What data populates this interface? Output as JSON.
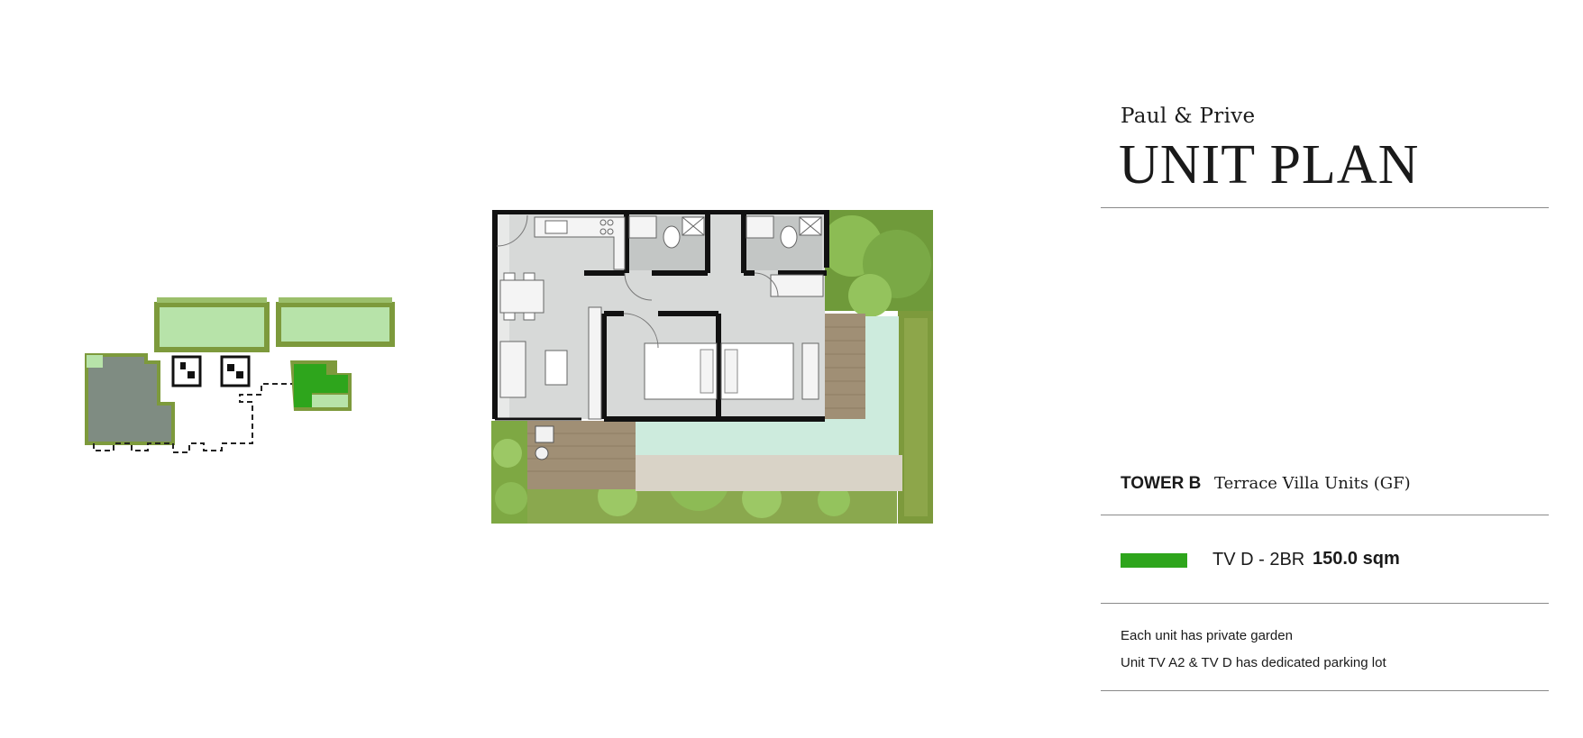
{
  "header": {
    "brand": "Paul & Prive",
    "title": "UNIT PLAN"
  },
  "tower": {
    "label": "TOWER B",
    "description": "Terrace Villa Units (GF)"
  },
  "legend": {
    "color": "#2ea51c",
    "unit_code": "TV D - 2BR",
    "area": "150.0 sqm"
  },
  "notes": [
    "Each unit has private garden",
    "Unit TV A2 & TV D has dedicated parking lot"
  ],
  "colors": {
    "highlight_unit": "#2ea51c",
    "garden_light": "#b7e3a9",
    "garden_dark": "#7d9a3c",
    "building_grey": "#7f8c82",
    "pool": "#cdebdd",
    "deck": "#a08f75",
    "interior": "#d7d9d8"
  }
}
